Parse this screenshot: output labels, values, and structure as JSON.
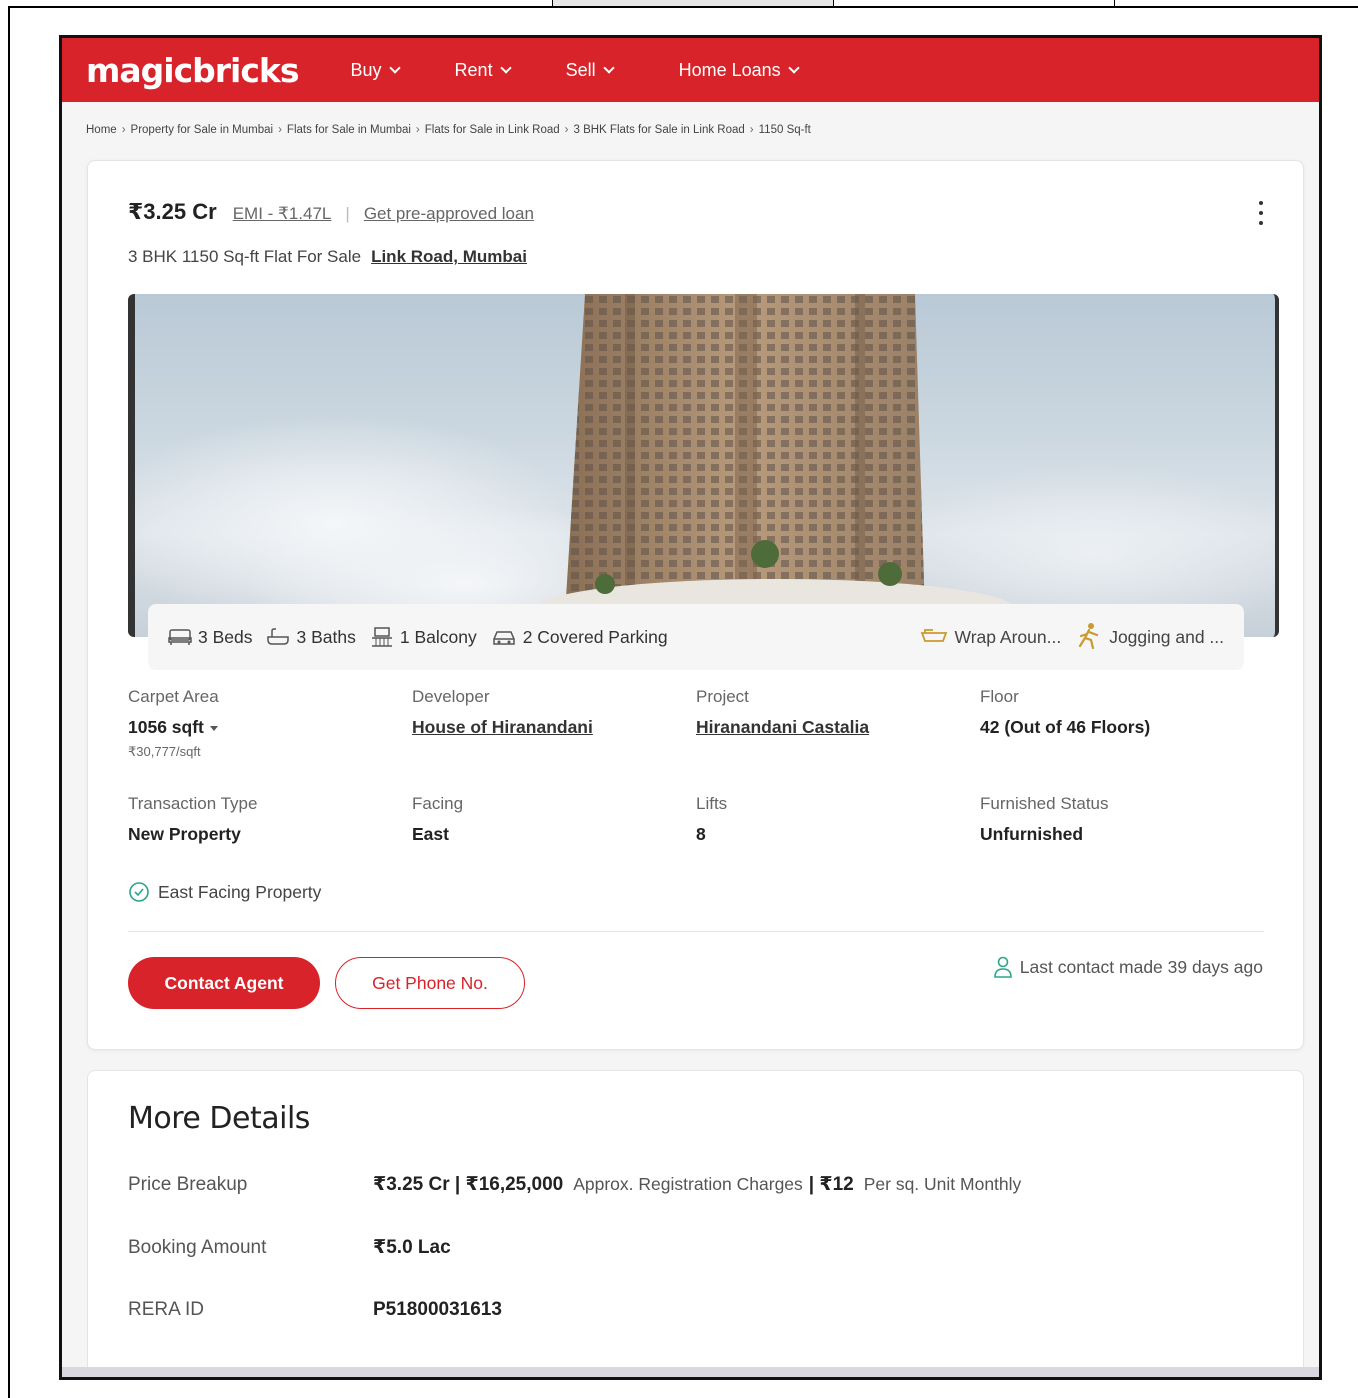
{
  "header": {
    "logo": "magicbricks",
    "nav": [
      {
        "label": "Buy"
      },
      {
        "label": "Rent"
      },
      {
        "label": "Sell"
      },
      {
        "label": "Home Loans"
      }
    ]
  },
  "breadcrumb": [
    "Home",
    "Property for Sale in Mumbai",
    "Flats for Sale in Mumbai",
    "Flats for Sale in Link Road",
    "3 BHK Flats for Sale in Link Road",
    "1150 Sq-ft"
  ],
  "listing": {
    "price": "₹3.25 Cr",
    "emi": "EMI - ₹1.47L",
    "loan_link": "Get pre-approved loan",
    "title": "3 BHK 1150 Sq-ft Flat For Sale",
    "location": "Link Road, Mumbai"
  },
  "amenities": {
    "beds": "3 Beds",
    "baths": "3 Baths",
    "balcony": "1 Balcony",
    "parking": "2 Covered Parking",
    "extra1": "Wrap Aroun...",
    "extra2": "Jogging and ..."
  },
  "details": {
    "carpet_label": "Carpet Area",
    "carpet_value": "1056 sqft",
    "carpet_rate": "₹30,777/sqft",
    "developer_label": "Developer",
    "developer_value": "House of Hiranandani",
    "project_label": "Project",
    "project_value": "Hiranandani Castalia",
    "floor_label": "Floor",
    "floor_value": "42 (Out of 46 Floors)",
    "transaction_label": "Transaction Type",
    "transaction_value": "New Property",
    "facing_label": "Facing",
    "facing_value": "East",
    "lifts_label": "Lifts",
    "lifts_value": "8",
    "furnished_label": "Furnished Status",
    "furnished_value": "Unfurnished",
    "tag": "East Facing Property"
  },
  "actions": {
    "contact": "Contact Agent",
    "phone": "Get Phone No.",
    "last_contact": "Last contact made 39 days ago"
  },
  "more": {
    "title": "More Details",
    "price_label": "Price Breakup",
    "price_value": "₹3.25 Cr | ₹16,25,000",
    "price_note": "Approx. Registration Charges",
    "price_value2": "| ₹12",
    "price_note2": "Per sq. Unit Monthly",
    "booking_label": "Booking Amount",
    "booking_value": "₹5.0 Lac",
    "rera_label": "RERA ID",
    "rera_value": "P51800031613"
  },
  "colors": {
    "brand": "#d8232a",
    "icon_amber": "#c99a2e",
    "check_green": "#2aa58a"
  }
}
